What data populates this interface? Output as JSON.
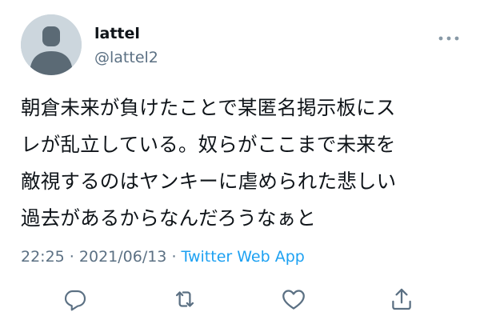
{
  "tweet": {
    "display_name": "lattel",
    "handle": "@lattel2",
    "body_lines": [
      "朝倉未来が負けたことで某匿名掲示板にス",
      "レが乱立している。奴らがここまで未来を",
      "敵視するのはヤンキーに虐められた悲しい",
      "過去があるからなんだろうなぁと"
    ],
    "time": "22:25",
    "separator_1": " · ",
    "date": "2021/06/13",
    "separator_2": " · ",
    "source": "Twitter Web App"
  },
  "icons": {
    "more": "more-horizontal-icon",
    "reply": "reply-icon",
    "retweet": "retweet-icon",
    "like": "heart-icon",
    "share": "share-icon"
  },
  "colors": {
    "text_primary": "#0f1419",
    "text_secondary": "#5b7083",
    "link": "#1da1f2",
    "avatar_bg": "#ccd6dd",
    "avatar_fg": "#5b6a75"
  }
}
